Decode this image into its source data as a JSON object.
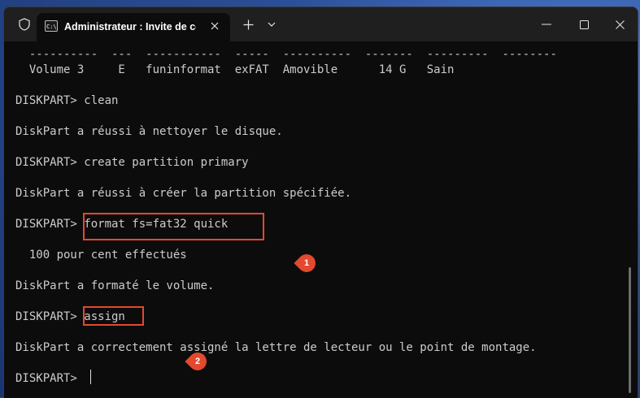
{
  "window": {
    "tab_title": "Administrateur : Invite de con",
    "tab_icon_text": "C:\\",
    "icons": [
      "shield-icon",
      "cmd-icon",
      "close-icon",
      "plus-icon",
      "chevron-down-icon",
      "minimize-icon",
      "maximize-icon",
      "close-icon"
    ]
  },
  "terminal": {
    "lines": [
      "  ----------  ---  -----------  -----  ----------  -------  ---------  --------",
      "  Volume 3     E   funinformat  exFAT  Amovible      14 G   Sain",
      "",
      "DISKPART> clean",
      "",
      "DiskPart a réussi à nettoyer le disque.",
      "",
      "DISKPART> create partition primary",
      "",
      "DiskPart a réussi à créer la partition spécifiée.",
      "",
      "DISKPART> format fs=fat32 quick",
      "",
      "  100 pour cent effectués",
      "",
      "DiskPart a formaté le volume.",
      "",
      "DISKPART> assign",
      "",
      "DiskPart a correctement assigné la lettre de lecteur ou le point de montage.",
      "",
      "DISKPART> "
    ]
  },
  "annotations": {
    "marker1": "1",
    "marker2": "2"
  },
  "colors": {
    "terminal_bg": "#0c0c0c",
    "terminal_fg": "#cccccc",
    "titlebar_bg": "#1f1f1f",
    "highlight": "#e2492f"
  }
}
